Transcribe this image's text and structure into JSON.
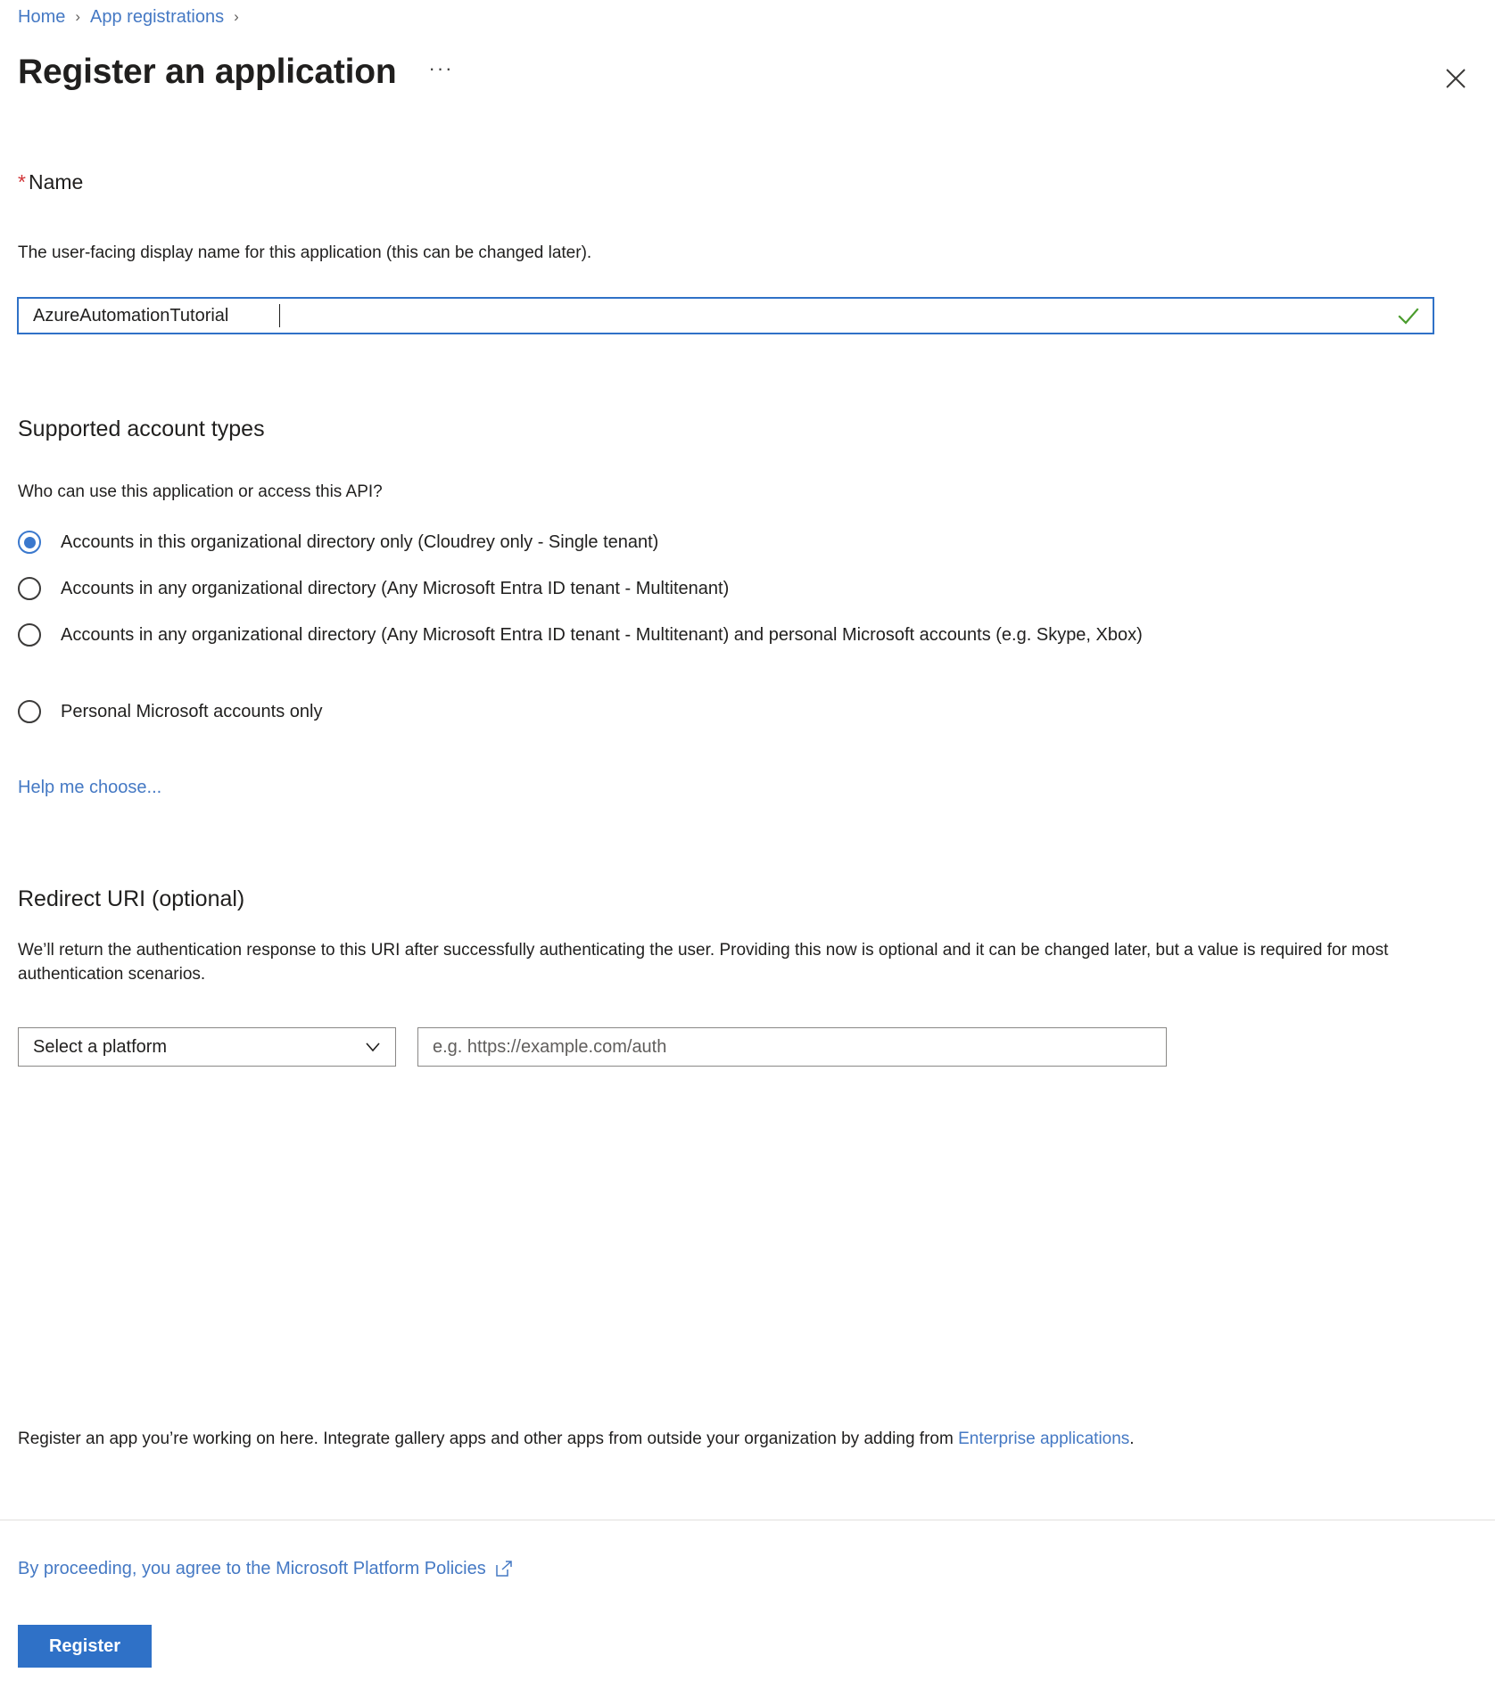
{
  "breadcrumb": {
    "items": [
      {
        "label": "Home"
      },
      {
        "label": "App registrations"
      }
    ],
    "separator": "›"
  },
  "header": {
    "title": "Register an application",
    "more_label": "···",
    "close_icon": "close-icon"
  },
  "name_section": {
    "required_marker": "*",
    "label": "Name",
    "description": "The user-facing display name for this application (this can be changed later).",
    "value": "AzureAutomationTutorial",
    "validation_icon": "checkmark-icon",
    "validation_color": "#4a9c2d"
  },
  "account_types": {
    "heading": "Supported account types",
    "question": "Who can use this application or access this API?",
    "options": [
      {
        "label": "Accounts in this organizational directory only (Cloudrey only - Single tenant)",
        "selected": true
      },
      {
        "label": "Accounts in any organizational directory (Any Microsoft Entra ID tenant - Multitenant)",
        "selected": false
      },
      {
        "label": "Accounts in any organizational directory (Any Microsoft Entra ID tenant - Multitenant) and personal Microsoft accounts (e.g. Skype, Xbox)",
        "selected": false
      },
      {
        "label": "Personal Microsoft accounts only",
        "selected": false
      }
    ],
    "help_link": "Help me choose..."
  },
  "redirect_uri": {
    "heading": "Redirect URI (optional)",
    "description": "We’ll return the authentication response to this URI after successfully authenticating the user. Providing this now is optional and it can be changed later, but a value is required for most authentication scenarios.",
    "platform_selected": "Select a platform",
    "uri_placeholder": "e.g. https://example.com/auth",
    "uri_value": ""
  },
  "footer": {
    "note_before_link": "Register an app you’re working on here. Integrate gallery apps and other apps from outside your organization by adding from ",
    "note_link": "Enterprise applications",
    "note_after_link": ".",
    "policy_text": "By proceeding, you agree to the Microsoft Platform Policies",
    "policy_icon": "external-link-icon",
    "register_label": "Register"
  },
  "colors": {
    "link": "#4579c4",
    "accent": "#2f71c7",
    "radio_selected": "#3a78cd",
    "required": "#d13438",
    "success": "#4a9c2d"
  }
}
